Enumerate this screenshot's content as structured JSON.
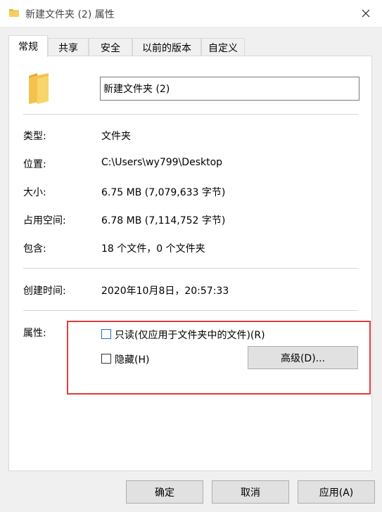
{
  "window": {
    "title": "新建文件夹 (2) 属性",
    "icon": "folder-icon",
    "close_icon": "close-icon"
  },
  "tabs": [
    {
      "label": "常规",
      "active": true
    },
    {
      "label": "共享"
    },
    {
      "label": "安全"
    },
    {
      "label": "以前的版本"
    },
    {
      "label": "自定义"
    }
  ],
  "general": {
    "folder_name": "新建文件夹 (2)",
    "type_label": "类型:",
    "type_value": "文件夹",
    "location_label": "位置:",
    "location_value": "C:\\Users\\wy799\\Desktop",
    "size_label": "大小:",
    "size_value": "6.75 MB (7,079,633 字节)",
    "size_on_disk_label": "占用空间:",
    "size_on_disk_value": "6.78 MB (7,114,752 字节)",
    "contains_label": "包含:",
    "contains_value": "18 个文件，0 个文件夹",
    "created_label": "创建时间:",
    "created_value": "2020年10月8日，20:57:33",
    "attributes_label": "属性:",
    "readonly_label": "只读(仅应用于文件夹中的文件)(R)",
    "hidden_label": "隐藏(H)",
    "advanced_button": "高级(D)..."
  },
  "footer": {
    "ok": "确定",
    "cancel": "取消",
    "apply": "应用(A)"
  },
  "colors": {
    "highlight_border": "#e03c3c",
    "folder": "#f3c34d"
  }
}
